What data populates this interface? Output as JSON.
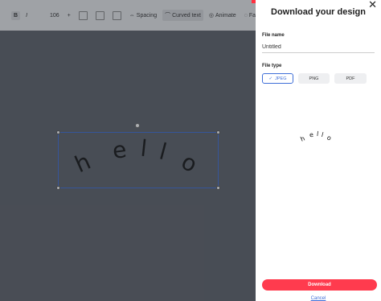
{
  "toolbar": {
    "bold_label": "B",
    "italic_label": "I",
    "font_size": "106",
    "spacing_label": "Spacing",
    "curved_text_label": "Curved text",
    "animate_label": "Animate",
    "fade_label": "Fade a"
  },
  "canvas": {
    "letters": [
      "h",
      "e",
      "l",
      "l",
      "o"
    ]
  },
  "panel": {
    "title": "Download your design",
    "file_name_label": "File name",
    "file_name_value": "Untitled",
    "file_type_label": "File type",
    "file_types": [
      "JPEG",
      "PNG",
      "PDF"
    ],
    "selected_type": "JPEG",
    "preview_text": [
      "h",
      "e",
      "l",
      "l",
      "o"
    ],
    "download_label": "Download",
    "cancel_label": "Cancel",
    "close_icon": "close-icon"
  },
  "colors": {
    "accent": "#3f6fd8",
    "download": "#ff3b4e",
    "overlay": "#3a3f47"
  }
}
